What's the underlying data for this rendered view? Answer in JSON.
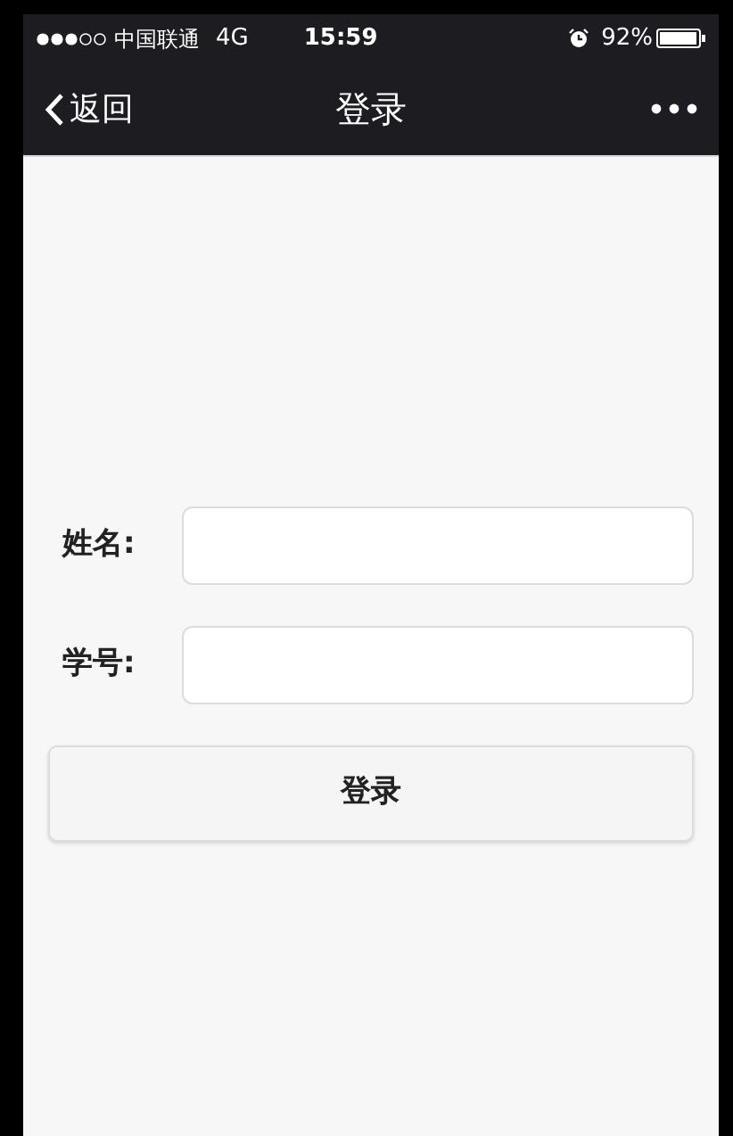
{
  "status_bar": {
    "carrier": "中国联通",
    "network": "4G",
    "time": "15:59",
    "battery": "92%"
  },
  "nav_bar": {
    "back": "返回",
    "title": "登录"
  },
  "form": {
    "fields": [
      {
        "label": "姓名:"
      },
      {
        "label": "学号:"
      }
    ],
    "submit": "登录"
  }
}
